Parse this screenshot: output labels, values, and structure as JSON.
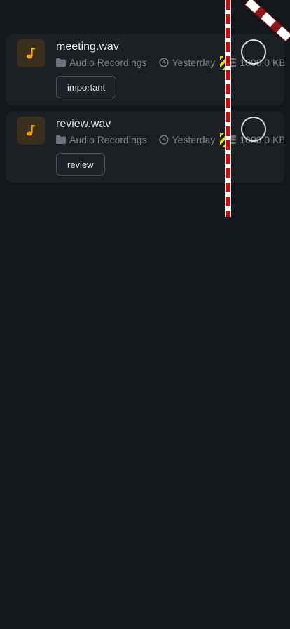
{
  "files": [
    {
      "name": "meeting.wav",
      "folder": "Audio Recordings",
      "modified": "Yesterday",
      "size": "1000.0 KB",
      "tag": "important",
      "icon": "music-note-icon"
    },
    {
      "name": "review.wav",
      "folder": "Audio Recordings",
      "modified": "Yesterday",
      "size": "1000.0 KB",
      "tag": "review",
      "icon": "music-note-icon"
    }
  ],
  "colors": {
    "background": "#13161a",
    "card": "#1b1f24",
    "accent_orange": "#f0a020",
    "icon_bg": "#3a2e1c",
    "text_primary": "#e6e8ea",
    "text_secondary": "#7e848b"
  }
}
